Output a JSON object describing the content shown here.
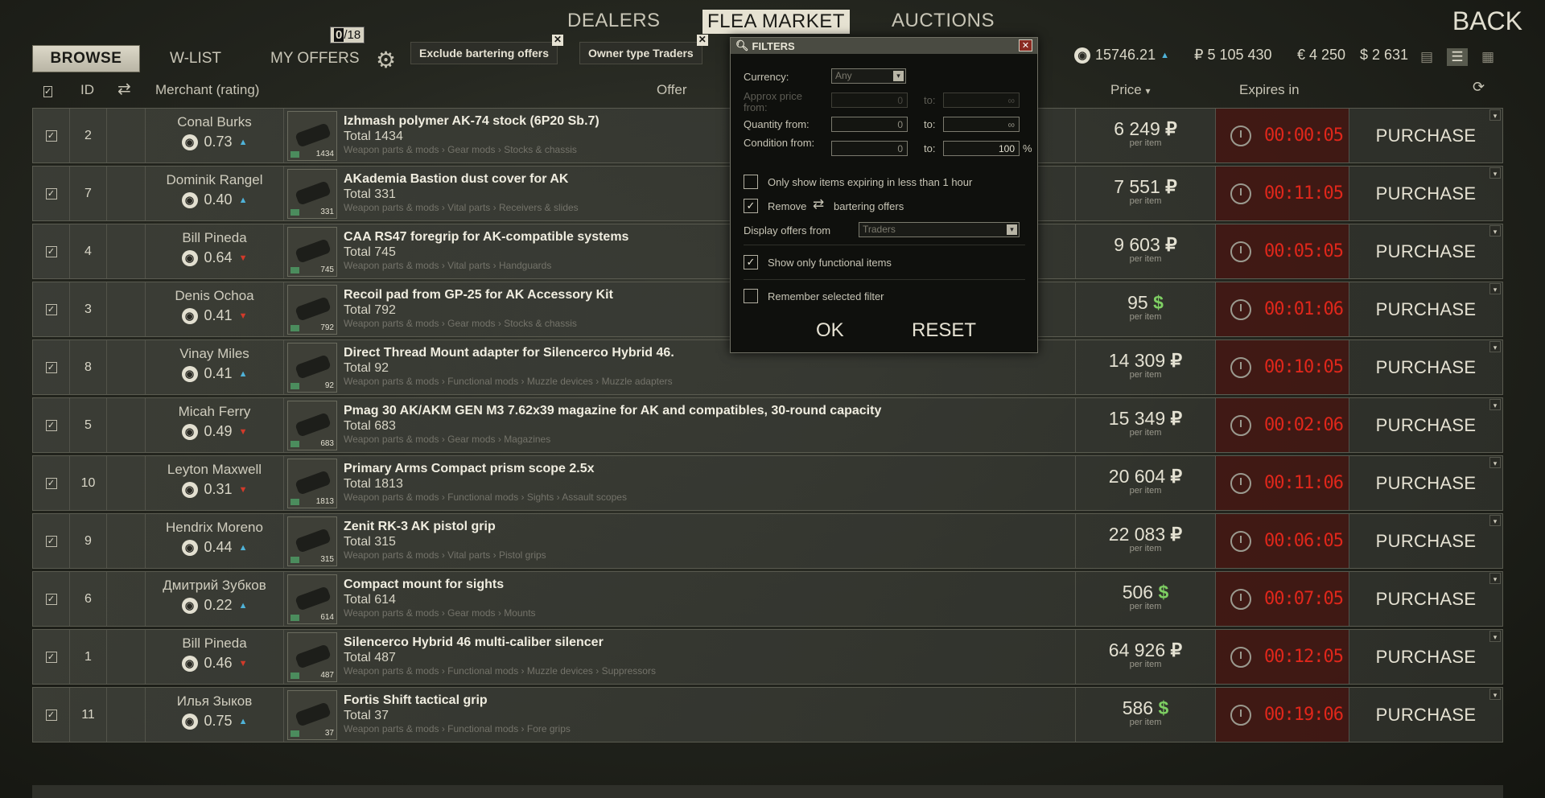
{
  "nav": {
    "dealers": "DEALERS",
    "flea_market": "FLEA MARKET",
    "auctions": "AUCTIONS",
    "back": "BACK"
  },
  "subnav": {
    "browse": "BROWSE",
    "wlist": "W-LIST",
    "my_offers": "MY OFFERS",
    "offers_used": "0",
    "offers_max": "/18",
    "chips": [
      {
        "label": "Exclude bartering offers"
      },
      {
        "label": "Owner type Traders"
      }
    ],
    "reputation": "15746.21",
    "rub": "₽ 5 105 430",
    "eur": "€ 4 250",
    "usd": "$ 2 631"
  },
  "table": {
    "headers": {
      "id": "ID",
      "merchant": "Merchant (rating)",
      "offer": "Offer",
      "price": "Price",
      "expires": "Expires in"
    },
    "purchase_label": "PURCHASE",
    "per_item": "per item",
    "rows": [
      {
        "id": "2",
        "merchant": "Conal Burks",
        "rating": "0.73",
        "trend": "up",
        "name": "Izhmash polymer AK-74 stock (6P20 Sb.7)",
        "total": "Total 1434",
        "category": "Weapon parts & mods › Gear mods › Stocks & chassis",
        "count": "1434",
        "price": "6 249",
        "currency": "₽",
        "timer": "00:00:05"
      },
      {
        "id": "7",
        "merchant": "Dominik Rangel",
        "rating": "0.40",
        "trend": "up",
        "name": "AKademia Bastion dust cover for AK",
        "total": "Total 331",
        "category": "Weapon parts & mods › Vital parts › Receivers & slides",
        "count": "331",
        "price": "7 551",
        "currency": "₽",
        "timer": "00:11:05"
      },
      {
        "id": "4",
        "merchant": "Bill Pineda",
        "rating": "0.64",
        "trend": "down",
        "name": "CAA RS47 foregrip for AK-compatible systems",
        "total": "Total 745",
        "category": "Weapon parts & mods › Vital parts › Handguards",
        "count": "745",
        "price": "9 603",
        "currency": "₽",
        "timer": "00:05:05"
      },
      {
        "id": "3",
        "merchant": "Denis Ochoa",
        "rating": "0.41",
        "trend": "down",
        "name": "Recoil pad from GP-25 for AK Accessory Kit",
        "total": "Total 792",
        "category": "Weapon parts & mods › Gear mods › Stocks & chassis",
        "count": "792",
        "price": "95",
        "currency": "$",
        "timer": "00:01:06"
      },
      {
        "id": "8",
        "merchant": "Vinay Miles",
        "rating": "0.41",
        "trend": "up",
        "name": "Direct Thread Mount adapter for Silencerco Hybrid 46.",
        "total": "Total 92",
        "category": "Weapon parts & mods › Functional mods › Muzzle devices › Muzzle adapters",
        "count": "92",
        "price": "14 309",
        "currency": "₽",
        "timer": "00:10:05"
      },
      {
        "id": "5",
        "merchant": "Micah Ferry",
        "rating": "0.49",
        "trend": "down",
        "name": "Pmag 30 AK/AKM GEN M3 7.62x39 magazine for AK and compatibles, 30-round capacity",
        "total": "Total 683",
        "category": "Weapon parts & mods › Gear mods › Magazines",
        "count": "683",
        "price": "15 349",
        "currency": "₽",
        "timer": "00:02:06"
      },
      {
        "id": "10",
        "merchant": "Leyton Maxwell",
        "rating": "0.31",
        "trend": "down",
        "name": "Primary Arms Compact prism scope 2.5x",
        "total": "Total 1813",
        "category": "Weapon parts & mods › Functional mods › Sights › Assault scopes",
        "count": "1813",
        "price": "20 604",
        "currency": "₽",
        "timer": "00:11:06"
      },
      {
        "id": "9",
        "merchant": "Hendrix Moreno",
        "rating": "0.44",
        "trend": "up",
        "name": "Zenit RK-3 AK pistol grip",
        "total": "Total 315",
        "category": "Weapon parts & mods › Vital parts › Pistol grips",
        "count": "315",
        "price": "22 083",
        "currency": "₽",
        "timer": "00:06:05"
      },
      {
        "id": "6",
        "merchant": "Дмитрий Зубков",
        "rating": "0.22",
        "trend": "up",
        "name": "Compact mount for sights",
        "total": "Total 614",
        "category": "Weapon parts & mods › Gear mods › Mounts",
        "count": "614",
        "price": "506",
        "currency": "$",
        "timer": "00:07:05"
      },
      {
        "id": "1",
        "merchant": "Bill Pineda",
        "rating": "0.46",
        "trend": "down",
        "name": "Silencerco Hybrid 46 multi-caliber silencer",
        "total": "Total 487",
        "category": "Weapon parts & mods › Functional mods › Muzzle devices › Suppressors",
        "count": "487",
        "price": "64 926",
        "currency": "₽",
        "timer": "00:12:05"
      },
      {
        "id": "11",
        "merchant": "Илья Зыков",
        "rating": "0.75",
        "trend": "up",
        "name": "Fortis Shift tactical grip",
        "total": "Total 37",
        "category": "Weapon parts & mods › Functional mods › Fore grips",
        "count": "37",
        "price": "586",
        "currency": "$",
        "timer": "00:19:06"
      }
    ]
  },
  "filters": {
    "title": "FILTERS",
    "currency_label": "Currency:",
    "currency_value": "Any",
    "approx_price_label": "Approx price from:",
    "to_label": "to:",
    "quantity_label": "Quantity from:",
    "condition_label": "Condition from:",
    "from_placeholder": "0",
    "to_placeholder": "∞",
    "condition_to": "100",
    "percent": "%",
    "expiring_label": "Only show items expiring in less than 1 hour",
    "remove_label": "Remove",
    "bartering_label": "bartering offers",
    "display_from_label": "Display offers from",
    "display_from_value": "Traders",
    "functional_label": "Show only functional items",
    "remember_label": "Remember selected filter",
    "ok": "OK",
    "reset": "RESET"
  }
}
